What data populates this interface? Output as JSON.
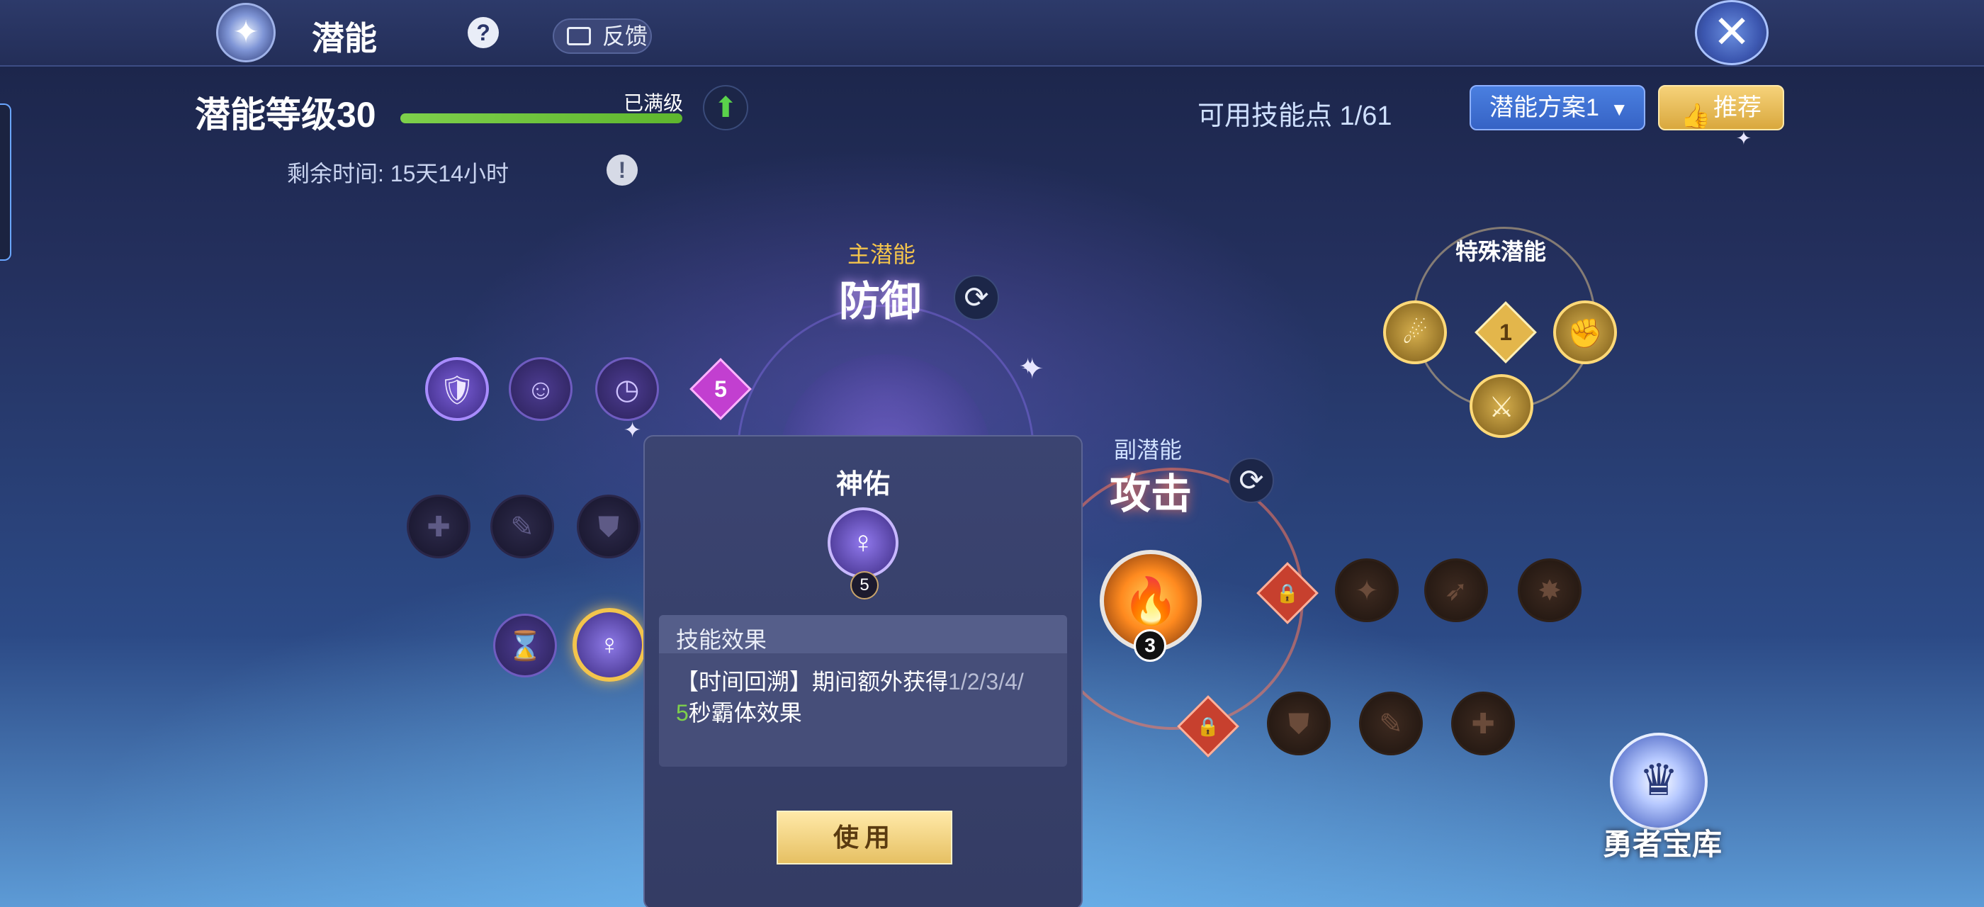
{
  "header": {
    "title": "潜能",
    "help_label": "?",
    "feedback_label": "反馈",
    "close_label": "✕"
  },
  "level": {
    "label": "潜能等级30",
    "status": "已满级",
    "progress": 1.0,
    "upgrade_icon": "up-arrow-icon"
  },
  "time_left": "剩余时间: 15天14小时",
  "points": "可用技能点 1/61",
  "plan_button": "潜能方案1",
  "recommend_button": "推荐",
  "main_tree": {
    "caption": "主潜能",
    "name": "防御",
    "level_badge": "5"
  },
  "sub_tree": {
    "caption": "副潜能",
    "name": "攻击",
    "level_badge": "3"
  },
  "special_tree": {
    "caption": "特殊潜能",
    "level_badge": "1"
  },
  "popup": {
    "title": "神佑",
    "level": "5",
    "effect_title": "技能效果",
    "effect_text": {
      "part1": "【时间回溯】期间额外获得",
      "values_gray": "1/2/3/4/",
      "values_green": "5",
      "part2": "秒霸体效果"
    },
    "use_button": "使用"
  },
  "vault": {
    "label": "勇者宝库"
  },
  "colors": {
    "accent_gold": "#f3c44c",
    "progress_green": "#7ed04b",
    "plan_blue": "#3663c5",
    "recommend_gold": "#d9a83d"
  }
}
